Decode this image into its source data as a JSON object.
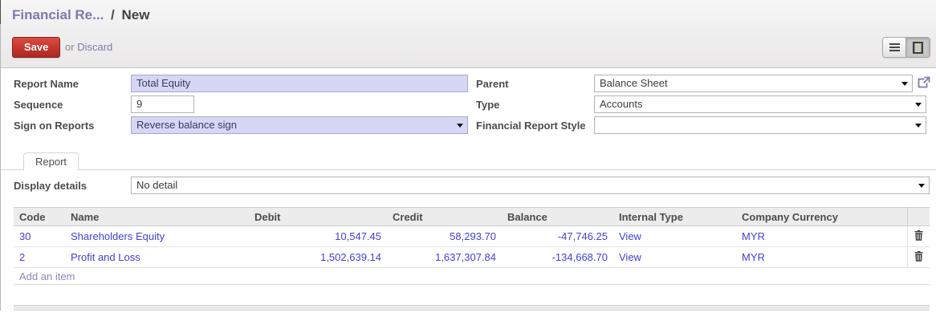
{
  "breadcrumb": {
    "parent": "Financial Re...",
    "separator": "/",
    "current": "New"
  },
  "toolbar": {
    "save_label": "Save",
    "or_label": "or",
    "discard_label": "Discard"
  },
  "view_switcher": {
    "list": "list-view",
    "form": "form-view",
    "active": "form"
  },
  "form": {
    "report_name": {
      "label": "Report Name",
      "value": "Total Equity"
    },
    "sequence": {
      "label": "Sequence",
      "value": "9"
    },
    "sign_on_reports": {
      "label": "Sign on Reports",
      "value": "Reverse balance sign"
    },
    "parent": {
      "label": "Parent",
      "value": "Balance Sheet"
    },
    "type": {
      "label": "Type",
      "value": "Accounts"
    },
    "financial_report_style": {
      "label": "Financial Report Style",
      "value": ""
    }
  },
  "tabs": {
    "report": "Report"
  },
  "display_details": {
    "label": "Display details",
    "value": "No detail"
  },
  "table": {
    "headers": [
      "Code",
      "Name",
      "Debit",
      "Credit",
      "Balance",
      "Internal Type",
      "Company Currency"
    ],
    "rows": [
      {
        "code": "30",
        "name": "Shareholders Equity",
        "debit": "10,547.45",
        "credit": "58,293.70",
        "balance": "-47,746.25",
        "internal_type": "View",
        "company_currency": "MYR"
      },
      {
        "code": "2",
        "name": "Profit and Loss",
        "debit": "1,502,639.14",
        "credit": "1,637,307.84",
        "balance": "-134,668.70",
        "internal_type": "View",
        "company_currency": "MYR"
      }
    ],
    "add_item_label": "Add an item"
  },
  "colors": {
    "accent_purple": "#7c7bad",
    "save_red": "#c0332b",
    "link_blue": "#4141dc",
    "required_field_bg": "#d6d6f5",
    "header_bg": "#ececec"
  }
}
